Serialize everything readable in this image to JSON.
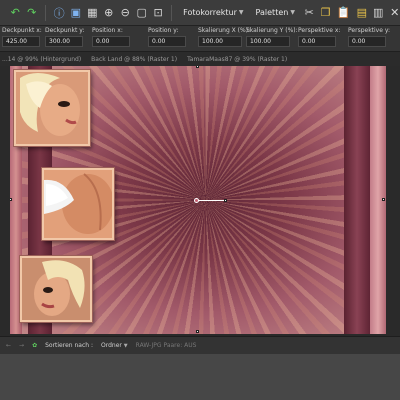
{
  "toolbar": {
    "menus": [
      {
        "label": "Fotokorrektur"
      },
      {
        "label": "Paletten"
      }
    ],
    "icons": [
      "undo-icon",
      "redo-icon",
      "info-icon",
      "image-icon",
      "grid-icon",
      "zoom-in-icon",
      "zoom-out-icon",
      "fit-window-icon",
      "cut-icon",
      "copy-icon",
      "paste-icon",
      "paste-layer-icon",
      "paste-selection-icon",
      "close-icon"
    ]
  },
  "options": [
    {
      "label": "Deckpunkt x:",
      "value": "425.00"
    },
    {
      "label": "Deckpunkt y:",
      "value": "300.00"
    },
    {
      "label": "Position x:",
      "value": "0.00"
    },
    {
      "label": "Position y:",
      "value": "0.00"
    },
    {
      "label": "Skalierung X (%):",
      "value": "100.00"
    },
    {
      "label": "Skalierung Y (%):",
      "value": "100.00"
    },
    {
      "label": "Perspektive x:",
      "value": "0.00"
    },
    {
      "label": "Perspektive y:",
      "value": "0.00"
    }
  ],
  "tabs": [
    {
      "label": "...14 @ 99% (Hintergrund)"
    },
    {
      "label": "Back Land @ 88% (Raster 1)"
    },
    {
      "label": "TamaraMaas87 @ 39% (Raster 1)"
    }
  ],
  "bottombar": {
    "sort_label": "Sortieren nach :",
    "sort_value": "Ordner",
    "format_label": "RAW-JPG Paare: AUS"
  },
  "colors": {
    "accent_green": "#5fcf5f",
    "canvas_center": "#5e2636",
    "canvas_edge": "#c48a8a",
    "frame_border": "#f1c8a8"
  }
}
